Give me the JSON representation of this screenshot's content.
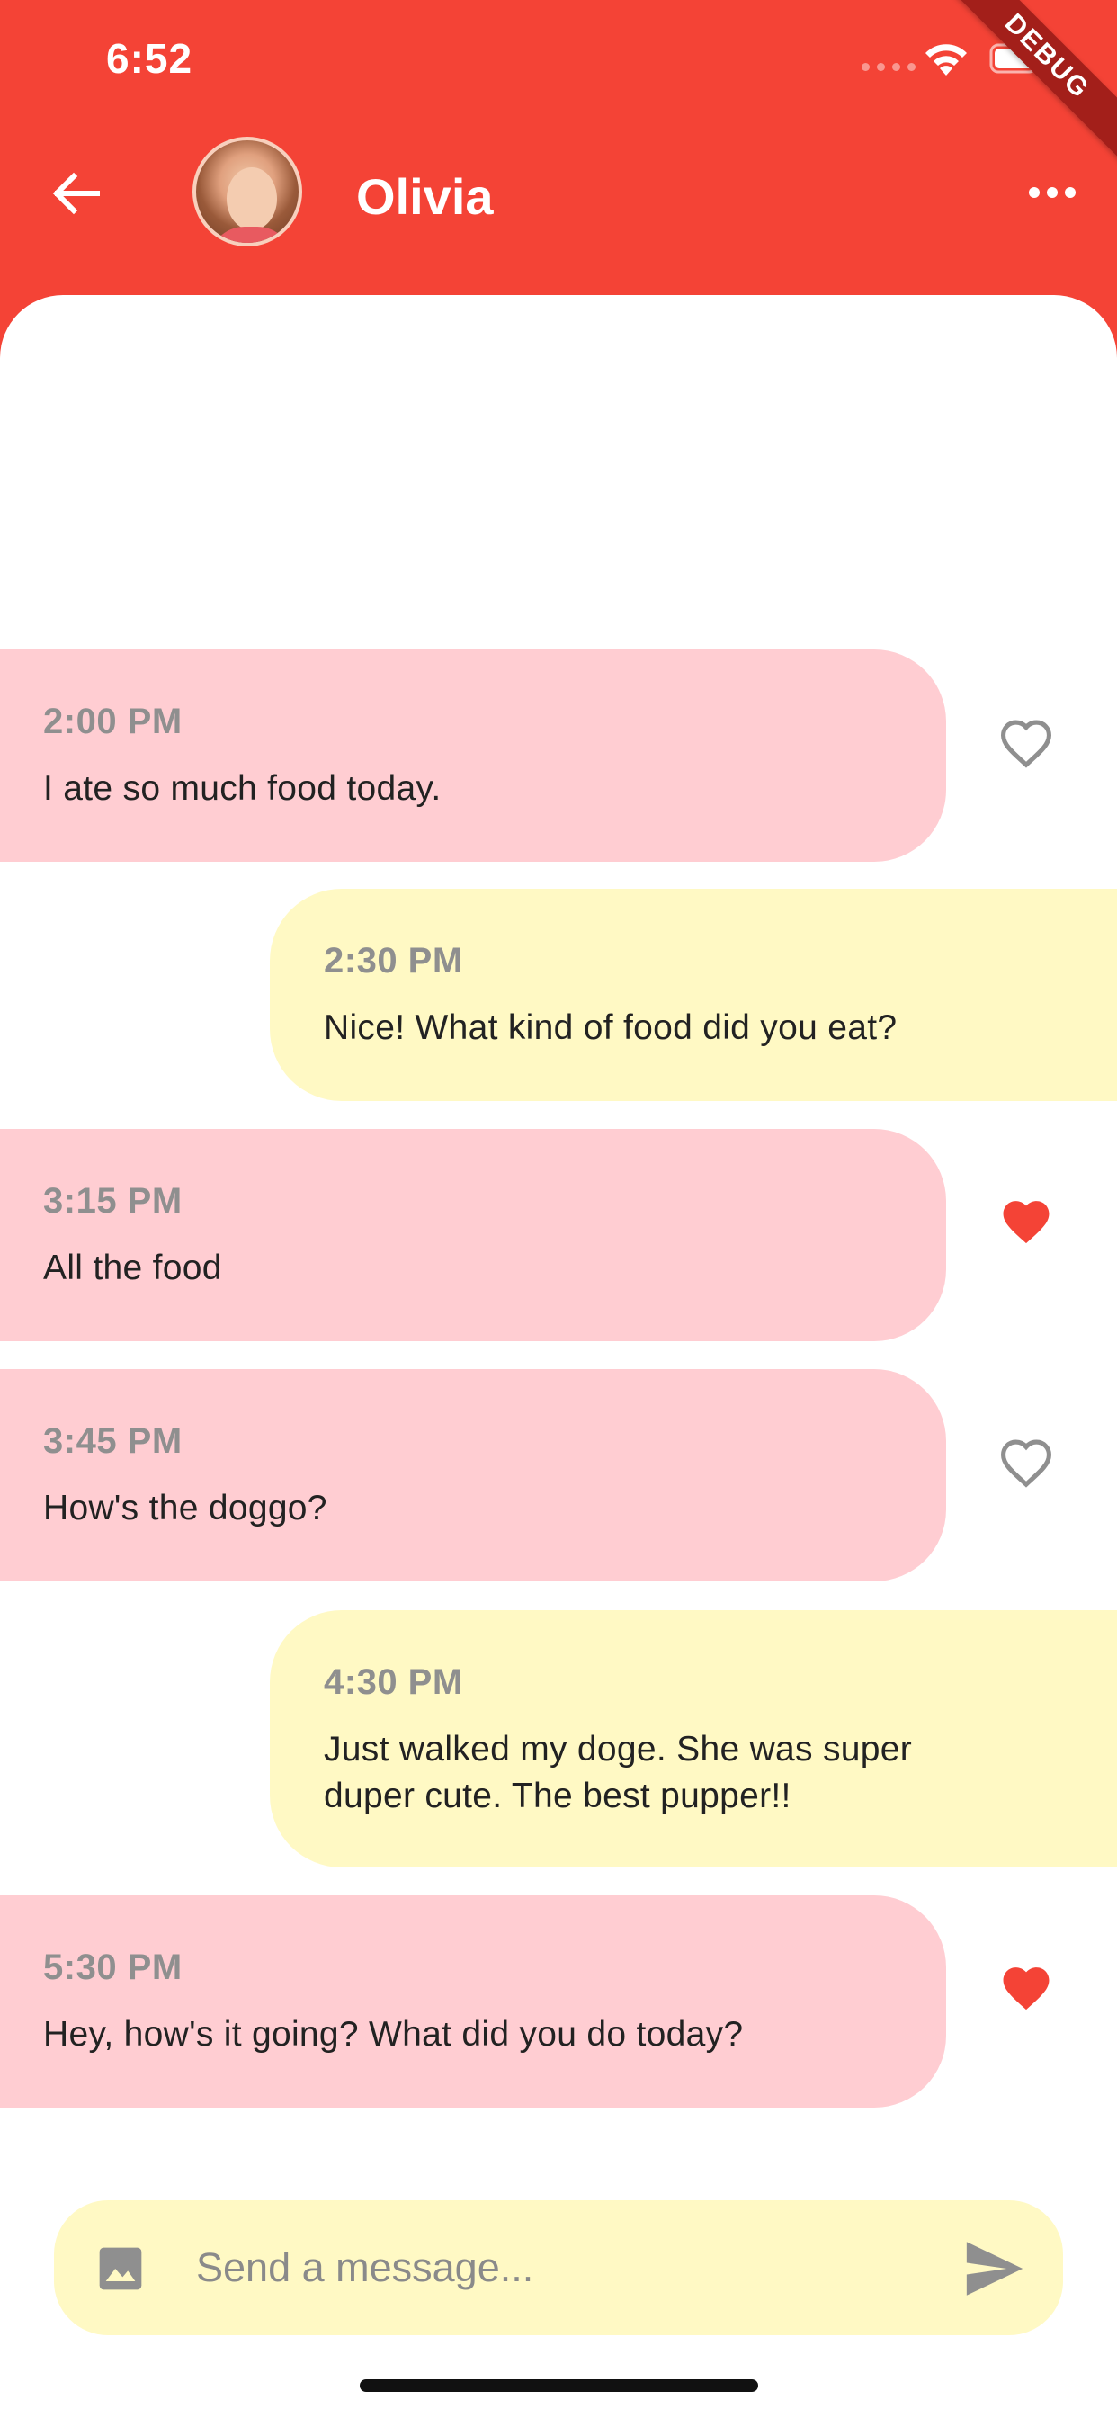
{
  "status_bar": {
    "time": "6:52"
  },
  "debug_banner": "DEBUG",
  "header": {
    "contact_name": "Olivia"
  },
  "messages": [
    {
      "time": "2:00 PM",
      "text": "I ate so much food today.",
      "side": "received",
      "liked": false
    },
    {
      "time": "2:30 PM",
      "text": "Nice! What kind of food did you eat?",
      "side": "sent"
    },
    {
      "time": "3:15 PM",
      "text": "All the food",
      "side": "received",
      "liked": true
    },
    {
      "time": "3:45 PM",
      "text": "How's the doggo?",
      "side": "received",
      "liked": false
    },
    {
      "time": "4:30 PM",
      "text": "Just walked my doge. She was super duper cute. The best pupper!!",
      "side": "sent"
    },
    {
      "time": "5:30 PM",
      "text": "Hey, how's it going? What did you do today?",
      "side": "received",
      "liked": true
    }
  ],
  "composer": {
    "placeholder": "Send a message..."
  },
  "colors": {
    "app_bar": "#f44336",
    "received_bubble": "#ffcdd2",
    "sent_bubble": "#fff9c4",
    "heart_liked": "#f44336",
    "heart_unliked": "#8f8f8f"
  },
  "icons": [
    "back-arrow-icon",
    "more-horiz-icon",
    "heart-icon",
    "heart-outline-icon",
    "image-icon",
    "send-icon",
    "wifi-icon",
    "battery-icon"
  ]
}
